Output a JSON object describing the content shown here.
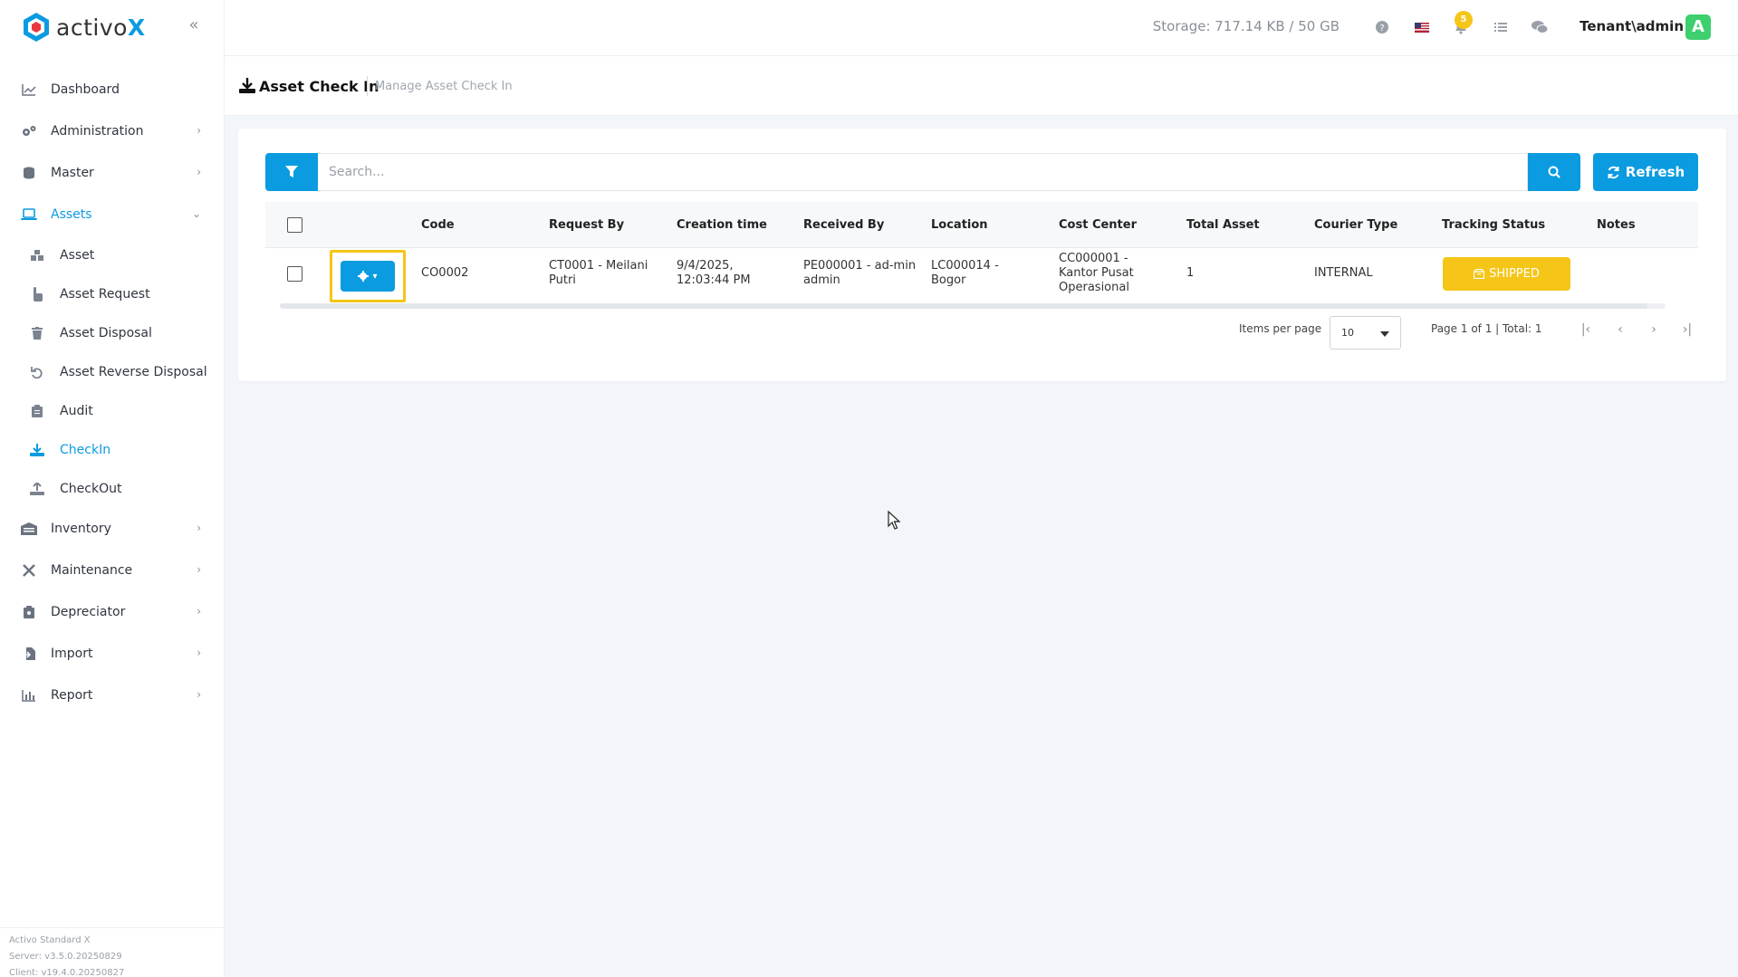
{
  "brand": {
    "name_main": "activo",
    "name_accent": "X"
  },
  "sidebar": {
    "items": [
      {
        "label": "Dashboard",
        "icon": "chart-line-icon",
        "expandable": false
      },
      {
        "label": "Administration",
        "icon": "gears-icon",
        "expandable": true
      },
      {
        "label": "Master",
        "icon": "database-icon",
        "expandable": true
      },
      {
        "label": "Assets",
        "icon": "laptop-icon",
        "expandable": true,
        "expanded": true,
        "active": true,
        "children": [
          {
            "label": "Asset",
            "icon": "cubes-icon"
          },
          {
            "label": "Asset Request",
            "icon": "hand-pointer-icon"
          },
          {
            "label": "Asset Disposal",
            "icon": "trash-icon"
          },
          {
            "label": "Asset Reverse Disposal",
            "icon": "undo-icon"
          },
          {
            "label": "Audit",
            "icon": "clipboard-icon"
          },
          {
            "label": "CheckIn",
            "icon": "download-icon",
            "active": true
          },
          {
            "label": "CheckOut",
            "icon": "upload-icon"
          }
        ]
      },
      {
        "label": "Inventory",
        "icon": "warehouse-icon",
        "expandable": true
      },
      {
        "label": "Maintenance",
        "icon": "tools-icon",
        "expandable": true
      },
      {
        "label": "Depreciator",
        "icon": "clipboard-dollar-icon",
        "expandable": true
      },
      {
        "label": "Import",
        "icon": "file-import-icon",
        "expandable": true
      },
      {
        "label": "Report",
        "icon": "chart-bar-icon",
        "expandable": true
      }
    ],
    "footer": {
      "product": "Activo Standard X",
      "server": "Server: v3.5.0.20250829",
      "client": "Client: v19.4.0.20250827"
    }
  },
  "topbar": {
    "storage": "Storage: 717.14 KB / 50 GB",
    "notification_count": "5",
    "user": "Tenant\\admin",
    "avatar_letter": "A"
  },
  "page": {
    "title": "Asset Check In",
    "subtitle": "Manage Asset Check In"
  },
  "toolbar": {
    "search_placeholder": "Search...",
    "refresh_label": "Refresh"
  },
  "table": {
    "columns": [
      "Code",
      "Request By",
      "Creation time",
      "Received By",
      "Location",
      "Cost Center",
      "Total Asset",
      "Courier Type",
      "Tracking Status",
      "Notes"
    ],
    "rows": [
      {
        "code": "CO0002",
        "request_by": "CT0001 - Meilani Putri",
        "creation_time": "9/4/2025, 12:03:44 PM",
        "received_by": "PE000001 - ad-min admin",
        "location": "LC000014 - Bogor",
        "cost_center": "CC000001 - Kantor Pusat Operasional",
        "total_asset": "1",
        "courier_type": "INTERNAL",
        "tracking_status": "SHIPPED",
        "notes": ""
      }
    ]
  },
  "pager": {
    "items_per_page_label": "Items per page",
    "items_per_page": "10",
    "page_info": "Page 1 of 1 | Total: 1"
  },
  "colors": {
    "accent": "#0b9be0",
    "highlight": "#f5c518",
    "avatar": "#3ecf6e"
  }
}
